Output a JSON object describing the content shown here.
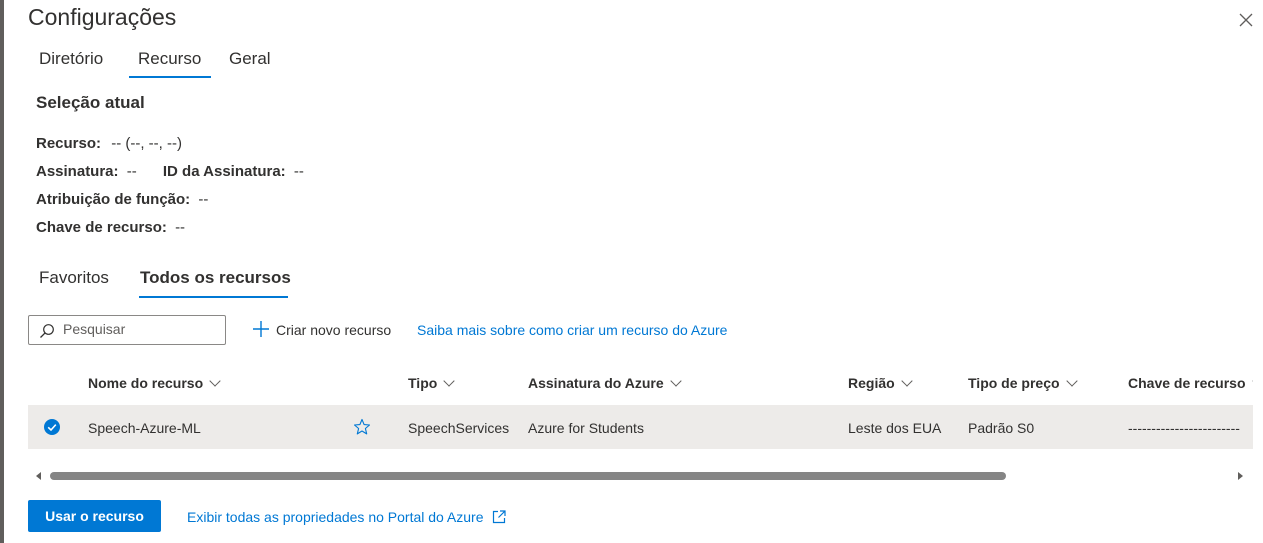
{
  "dialog": {
    "title": "Configurações",
    "close_label": ""
  },
  "top_tabs": [
    {
      "label": "Diretório",
      "selected": false
    },
    {
      "label": "Recurso",
      "selected": true
    },
    {
      "label": "Geral",
      "selected": false
    }
  ],
  "current_selection": {
    "heading": "Seleção atual",
    "resource_label": "Recurso:",
    "resource_value": "-- (--, --, --)",
    "subscription_label": "Assinatura:",
    "subscription_value": "--",
    "subscription_id_label": "ID da Assinatura:",
    "subscription_id_value": "--",
    "role_label": "Atribuição de função:",
    "role_value": "--",
    "key_label": "Chave de recurso:",
    "key_value": "--"
  },
  "resource_tabs": [
    {
      "label": "Favoritos",
      "selected": false
    },
    {
      "label": "Todos os recursos",
      "selected": true
    }
  ],
  "toolbar": {
    "search_placeholder": "Pesquisar",
    "create_label": "Criar novo recurso",
    "learn_more_label": "Saiba mais sobre como criar um recurso do Azure"
  },
  "table": {
    "columns": [
      "Nome do recurso",
      "Tipo",
      "Assinatura do Azure",
      "Região",
      "Tipo de preço",
      "Chave de recurso"
    ],
    "rows": [
      {
        "selected": true,
        "favorite": false,
        "name": "Speech-Azure-ML",
        "type": "SpeechServices",
        "subscription": "Azure for Students",
        "region": "Leste dos EUA",
        "pricing": "Padrão S0",
        "key": "------------------------"
      }
    ],
    "horizontal_scroll_fraction": 0.81
  },
  "footer": {
    "use_button": "Usar o recurso",
    "portal_link": "Exibir todas as propriedades no Portal do Azure"
  },
  "colors": {
    "accent": "#0078d4",
    "selected_row": "#edebe9",
    "text": "#323130"
  },
  "icons": [
    "close-icon",
    "search-icon",
    "plus-icon",
    "check-circle-icon",
    "star-outline-icon",
    "external-link-icon",
    "chevron-down-icon"
  ]
}
